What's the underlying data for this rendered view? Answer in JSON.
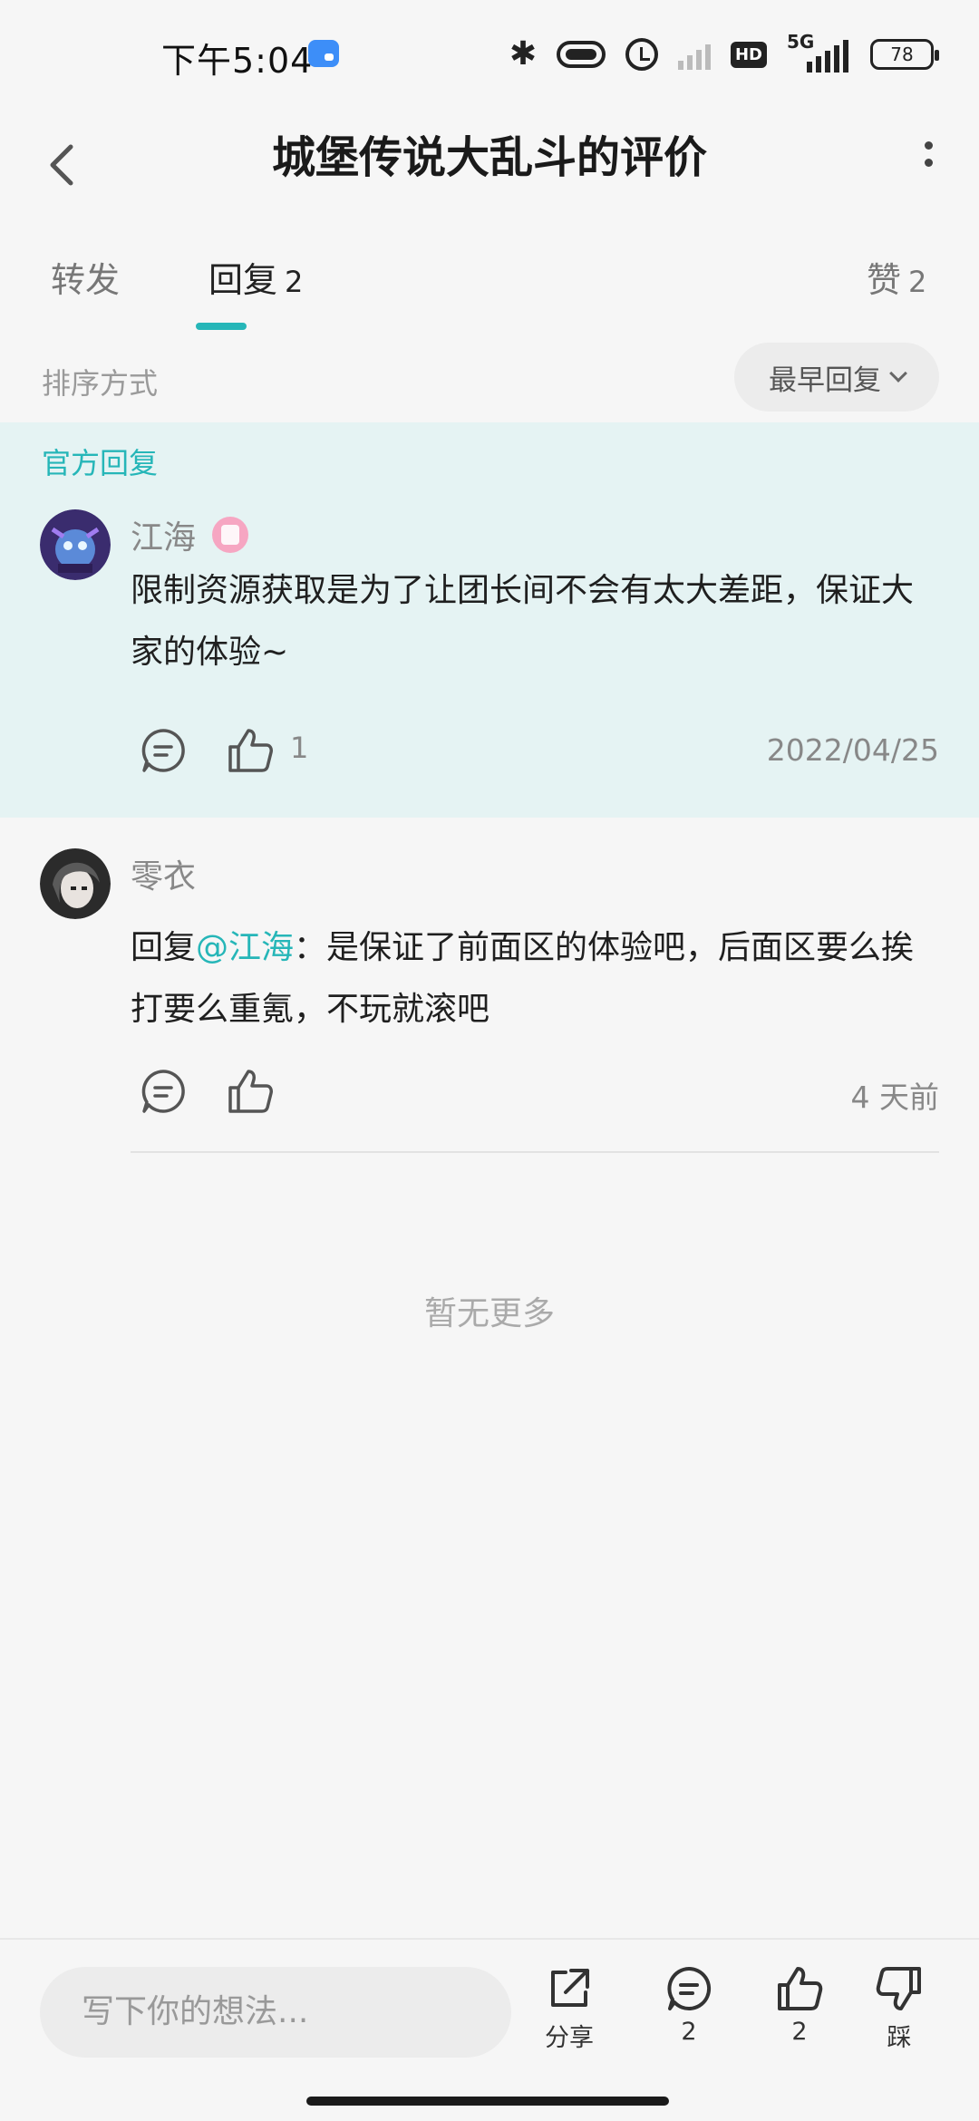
{
  "status_bar": {
    "time": "下午5:04",
    "network": "5G",
    "hd": "HD",
    "battery": "78",
    "icons": [
      "app-notification-icon",
      "bluetooth-icon",
      "vibrate-icon",
      "alarm-icon",
      "wifi-icon",
      "hd-icon",
      "signal-icon",
      "battery-icon"
    ]
  },
  "header": {
    "title": "城堡传说大乱斗的评价",
    "back_icon": "chevron-left-icon",
    "more_icon": "more-vertical-icon"
  },
  "tabs": [
    {
      "label": "转发",
      "count": ""
    },
    {
      "label": "回复",
      "count": "2",
      "active": true
    },
    {
      "label": "赞",
      "count": "2"
    }
  ],
  "accent_color": "#26b6b8",
  "sort": {
    "label": "排序方式",
    "value": "最早回复"
  },
  "official_reply": {
    "section_label": "官方回复",
    "user": "江海",
    "text": "限制资源获取是为了让团长间不会有太大差距，保证大家的体验~",
    "likes": "1",
    "date": "2022/04/25"
  },
  "replies": [
    {
      "user": "零衣",
      "prefix": "回复",
      "mention": "@江海",
      "text": "：是保证了前面区的体验吧，后面区要么挨打要么重氪，不玩就滚吧",
      "time": "4 天前"
    }
  ],
  "no_more": "暂无更多",
  "bottom_bar": {
    "input_placeholder": "写下你的想法...",
    "share_label": "分享",
    "comment_count": "2",
    "like_count": "2",
    "dislike_label": "踩"
  }
}
